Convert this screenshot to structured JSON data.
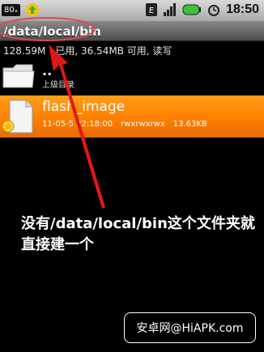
{
  "status_bar": {
    "badge": "80ₓ",
    "time": "18:50",
    "icons": [
      "app-notification-icon",
      "signal-icon",
      "bars-icon",
      "battery-icon",
      "alarm-icon"
    ]
  },
  "path_bar": {
    "path": "/data/local/bin"
  },
  "storage_summary": "128.59M　已用, 36.54MB 可用, 读写",
  "files": [
    {
      "name": "..",
      "subtitle": "上级目录",
      "icon": "folder-icon"
    },
    {
      "name": "flash_image",
      "date": "11-05-5 22:18:00",
      "perms": "rwxrwxrwx",
      "size": "13.63KB",
      "icon": "file-icon",
      "selected": true
    }
  ],
  "annotation_text": "没有/data/local/bin这个文件夹就直接建一个",
  "watermark_text": "安卓网@HiAPK.com",
  "colors": {
    "selection": "#ff8000",
    "arrow": "#e11111",
    "path_highlight": "#d94a55"
  }
}
